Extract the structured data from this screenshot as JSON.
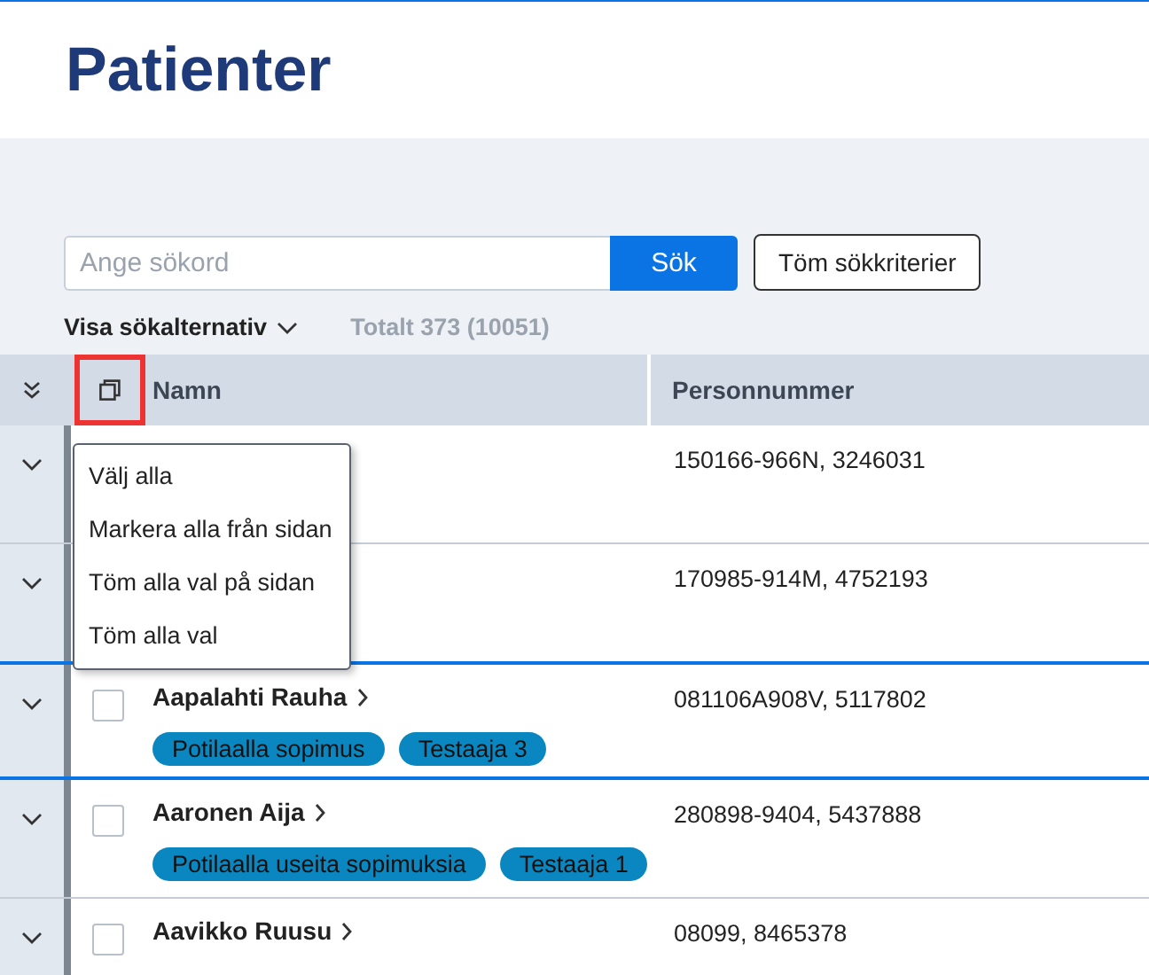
{
  "title": "Patienter",
  "search": {
    "placeholder": "Ange sökord",
    "button": "Sök",
    "clear_button": "Töm sökkriterier"
  },
  "options_toggle": "Visa sökalternativ",
  "total": "Totalt 373 (10051)",
  "table": {
    "select_all": {
      "highlighted": true
    },
    "columns": [
      "Namn",
      "Personnummer"
    ],
    "rows": [
      {
        "id_number": "150166-966N, 3246031",
        "highlighted": false
      },
      {
        "id_number": "170985-914M, 4752193",
        "highlighted": false
      },
      {
        "name": "Aapalahti Rauha",
        "id_number": "081106A908V, 5117802",
        "checked": false,
        "highlighted": true,
        "tags": [
          "Potilaalla sopimus",
          "Testaaja 3"
        ]
      },
      {
        "name": "Aaronen Aija",
        "id_number": "280898-9404, 5437888",
        "checked": false,
        "highlighted": false,
        "tags": [
          "Potilaalla useita sopimuksia",
          "Testaaja 1"
        ]
      },
      {
        "name": "Aavikko Ruusu",
        "id_number": "08099, 8465378",
        "checked": false,
        "highlighted": false
      }
    ]
  },
  "menu": {
    "items": [
      "Välj alla",
      "Markera alla från sidan",
      "Töm alla val på sidan",
      "Töm alla val"
    ]
  }
}
